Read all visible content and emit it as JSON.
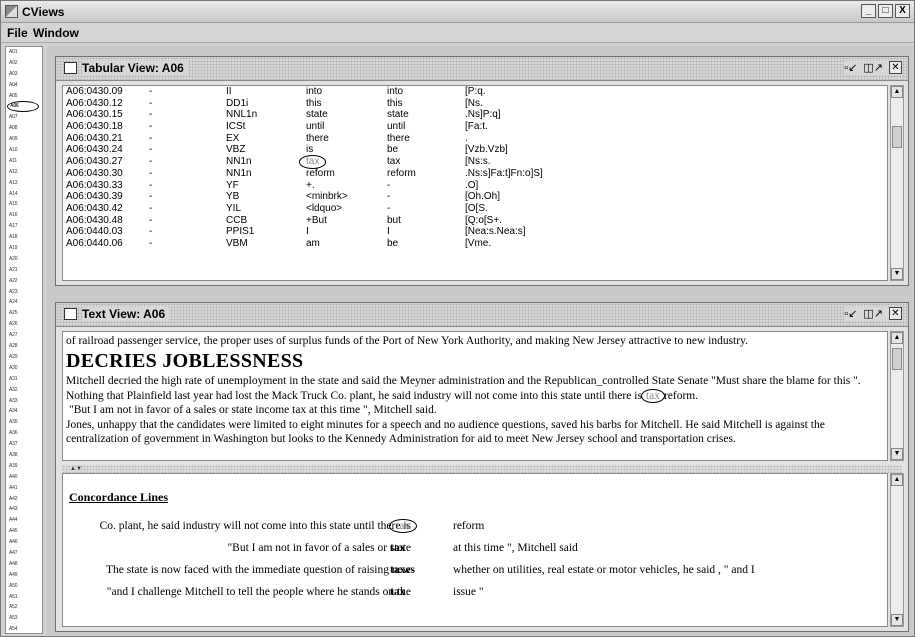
{
  "window": {
    "title": "CViews",
    "min": "_",
    "max": "□",
    "close": "X"
  },
  "menu": {
    "file": "File",
    "window": "Window"
  },
  "doc_list": [
    "A01",
    "A02",
    "A03",
    "A04",
    "A05",
    "A06",
    "A07",
    "A08",
    "A09",
    "A10",
    "A11",
    "A12",
    "A13",
    "A14",
    "A15",
    "A16",
    "A17",
    "A18",
    "A19",
    "A20",
    "A21",
    "A22",
    "A23",
    "A24",
    "A25",
    "A26",
    "A27",
    "A28",
    "A29",
    "A30",
    "A31",
    "A32",
    "A33",
    "A34",
    "A35",
    "A36",
    "A37",
    "A38",
    "A39",
    "A40",
    "A41",
    "A42",
    "A43",
    "A44",
    "A45",
    "A46",
    "A47",
    "A48",
    "A49",
    "A50",
    "A51",
    "A52",
    "A53",
    "A54"
  ],
  "doc_selected": "A06",
  "tabular": {
    "title": "Tabular View: A06",
    "rows": [
      [
        "A06:0430.09",
        "-",
        "II",
        "into",
        "into",
        "[P:q."
      ],
      [
        "A06:0430.12",
        "-",
        "DD1i",
        "this",
        "this",
        "[Ns."
      ],
      [
        "A06:0430.15",
        "-",
        "NNL1n",
        "state",
        "state",
        ".Ns]P:q]"
      ],
      [
        "A06:0430.18",
        "-",
        "ICSt",
        "until",
        "until",
        "[Fa:t."
      ],
      [
        "A06:0430.21",
        "-",
        "EX",
        "there",
        "there",
        "."
      ],
      [
        "A06:0430.24",
        "-",
        "VBZ",
        "is",
        "be",
        "[Vzb.Vzb]"
      ],
      [
        "A06:0430.27",
        "-",
        "NN1n",
        "tax",
        "tax",
        "[Ns:s."
      ],
      [
        "A06:0430.30",
        "-",
        "NN1n",
        "reform",
        "reform",
        ".Ns:s]Fa:t]Fn:o]S]"
      ],
      [
        "A06:0430.33",
        "-",
        "YF",
        "+.",
        "-",
        ".O]"
      ],
      [
        "A06:0430.39",
        "-",
        "YB",
        "<minbrk>",
        "-",
        "[Oh.Oh]"
      ],
      [
        "A06:0430.42",
        "-",
        "YIL",
        "<ldquo>",
        "-",
        "[O[S."
      ],
      [
        "A06:0430.48",
        "-",
        "CCB",
        "+But",
        "but",
        "[Q:o[S+."
      ],
      [
        "A06:0440.03",
        "-",
        "PPIS1",
        "I",
        "I",
        "[Nea:s.Nea:s]"
      ],
      [
        "A06:0440.06",
        "-",
        "VBM",
        "am",
        "be",
        "[Vme."
      ]
    ]
  },
  "text": {
    "title": "Text View: A06",
    "line1": "of railroad passenger service, the proper uses of surplus funds of the Port of New York Authority, and making New Jersey attractive to new industry.",
    "heading": "DECRIES JOBLESSNESS",
    "p1": "Mitchell decried the high rate of unemployment in the state and said the Meyner administration and the Republican_controlled State Senate \"Must share the blame for this \". Nothing that Plainfield last year had lost the Mack Truck Co. plant, he said industry will not come into this state until there is",
    "p1_key": "tax",
    "p1_end": "reform.",
    "p2": "\"But I am not in favor of a sales or state income tax at this time \", Mitchell said.",
    "p3": "Jones, unhappy that the candidates were limited to eight minutes for a speech and no audience questions, saved his barbs for Mitchell. He said Mitchell is against the centralization of government in Washington but looks to the Kennedy Administration for aid to meet New Jersey school and transportation crises."
  },
  "concordance": {
    "title": "Concordance Lines",
    "lines": [
      {
        "left": "Co. plant, he said industry will not come into this state until there is",
        "key": "tax",
        "right": "reform"
      },
      {
        "left": "\"But I am not in favor of a sales or state",
        "key": "tax",
        "right": "at this time \", Mitchell said"
      },
      {
        "left": "The state is now faced with the immediate question of raising new",
        "key": "taxes",
        "right": "whether on utilities, real estate or motor vehicles, he said , \" and I"
      },
      {
        "left": "\"and I challenge Mitchell to tell the people where he stands on the",
        "key": "tax",
        "right": "issue \""
      }
    ]
  }
}
